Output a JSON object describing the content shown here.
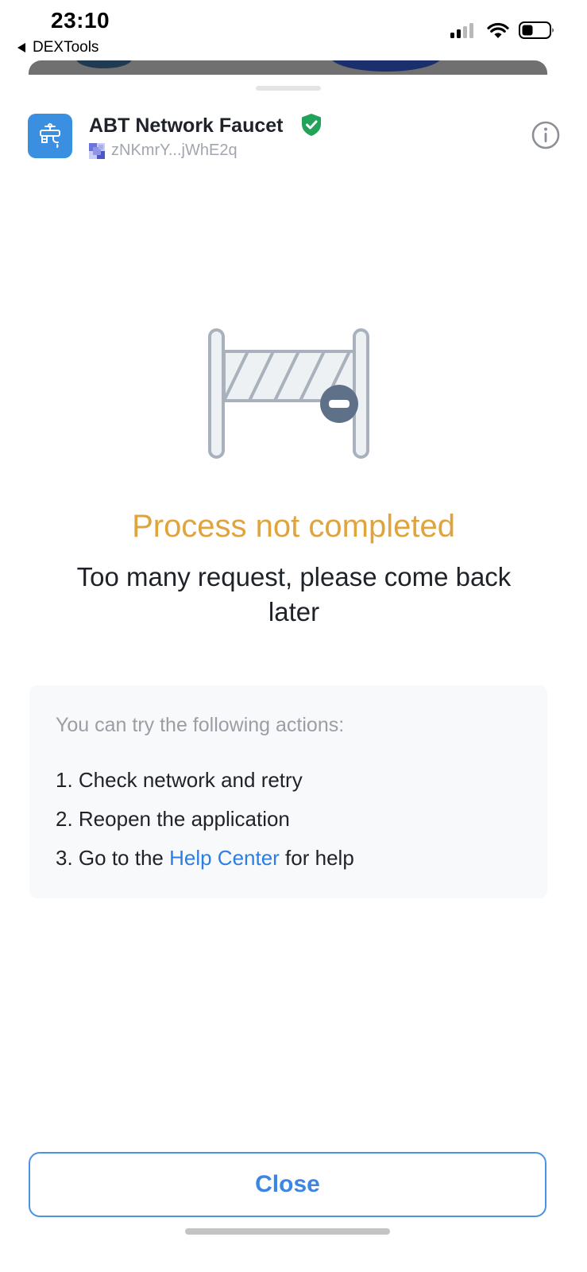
{
  "status_bar": {
    "time": "23:10",
    "back_app_label": "DEXTools"
  },
  "app": {
    "name": "ABT Network Faucet",
    "address": "zNKmrY...jWhE2q",
    "verified": true
  },
  "result": {
    "title": "Process not completed",
    "message": "Too many request, please come back later"
  },
  "suggestions": {
    "title": "You can try the following actions:",
    "item1": "1. Check network and retry",
    "item2": "2. Reopen the application",
    "item3_prefix": "3. Go to the ",
    "item3_link": "Help Center",
    "item3_suffix": " for help"
  },
  "actions": {
    "close_label": "Close"
  },
  "colors": {
    "accent": "#3a86e2",
    "warning_title": "#e0a43c",
    "verified": "#22a35a",
    "app_icon_bg": "#3a8fe0"
  },
  "icons": [
    "faucet-app-icon",
    "verified-shield-icon",
    "info-icon",
    "barrier-blocked-icon",
    "wifi-icon",
    "signal-icon",
    "battery-icon"
  ]
}
